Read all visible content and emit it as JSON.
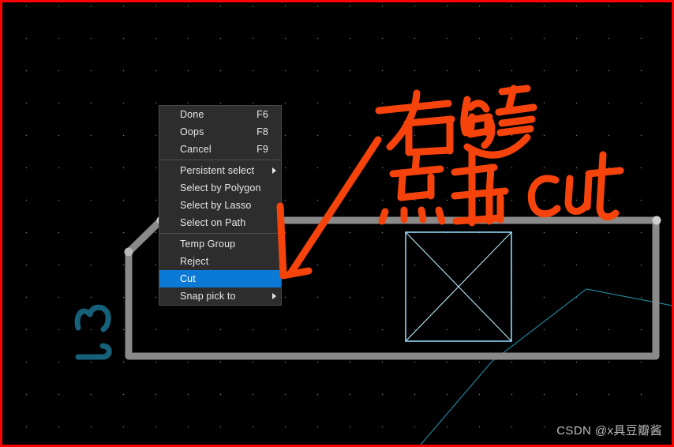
{
  "app": {
    "name": "pcb-cad-canvas",
    "background_color": "#000000",
    "border_color": "#fe0000",
    "grid_dot_color": "#8a8a8a"
  },
  "context_menu": {
    "name": "right-click-context-menu",
    "background_color": "#2d2d2d",
    "highlight_color": "#0b7ad6",
    "text_color": "#e8e8e8",
    "items": [
      {
        "label": "Done",
        "accel": "F6",
        "submenu": false,
        "selected": false
      },
      {
        "label": "Oops",
        "accel": "F8",
        "submenu": false,
        "selected": false
      },
      {
        "label": "Cancel",
        "accel": "F9",
        "submenu": false,
        "selected": false
      },
      {
        "label": "Persistent select",
        "accel": "",
        "submenu": true,
        "selected": false
      },
      {
        "label": "Select by Polygon",
        "accel": "",
        "submenu": false,
        "selected": false
      },
      {
        "label": "Select by Lasso",
        "accel": "",
        "submenu": false,
        "selected": false
      },
      {
        "label": "Select on Path",
        "accel": "",
        "submenu": false,
        "selected": false
      },
      {
        "label": "Temp Group",
        "accel": "",
        "submenu": false,
        "selected": false
      },
      {
        "label": "Reject",
        "accel": "",
        "submenu": false,
        "selected": false
      },
      {
        "label": "Cut",
        "accel": "",
        "submenu": false,
        "selected": true
      },
      {
        "label": "Snap pick to",
        "accel": "",
        "submenu": true,
        "selected": false
      }
    ]
  },
  "annotations": {
    "ink_color": "#f5430b",
    "line1": "右键",
    "line2_cn": "点击",
    "line2_en": "cut",
    "arrow": "arrow-pointing-to-cut-menu-item"
  },
  "canvas_objects": {
    "board_outline": {
      "name": "pcb-board-outline",
      "color": "#8a8a8a"
    },
    "component_box": {
      "name": "component-x-box",
      "color": "#8bd7f5"
    },
    "reference_designator": {
      "name": "refdes-j3",
      "label": "J3",
      "color": "#16607a"
    },
    "trace_lines": {
      "name": "cyan-trace-lines",
      "color": "#1f8fa6"
    }
  },
  "watermark": {
    "text": "CSDN @x具豆瓣酱",
    "color": "#d9d9d9"
  }
}
